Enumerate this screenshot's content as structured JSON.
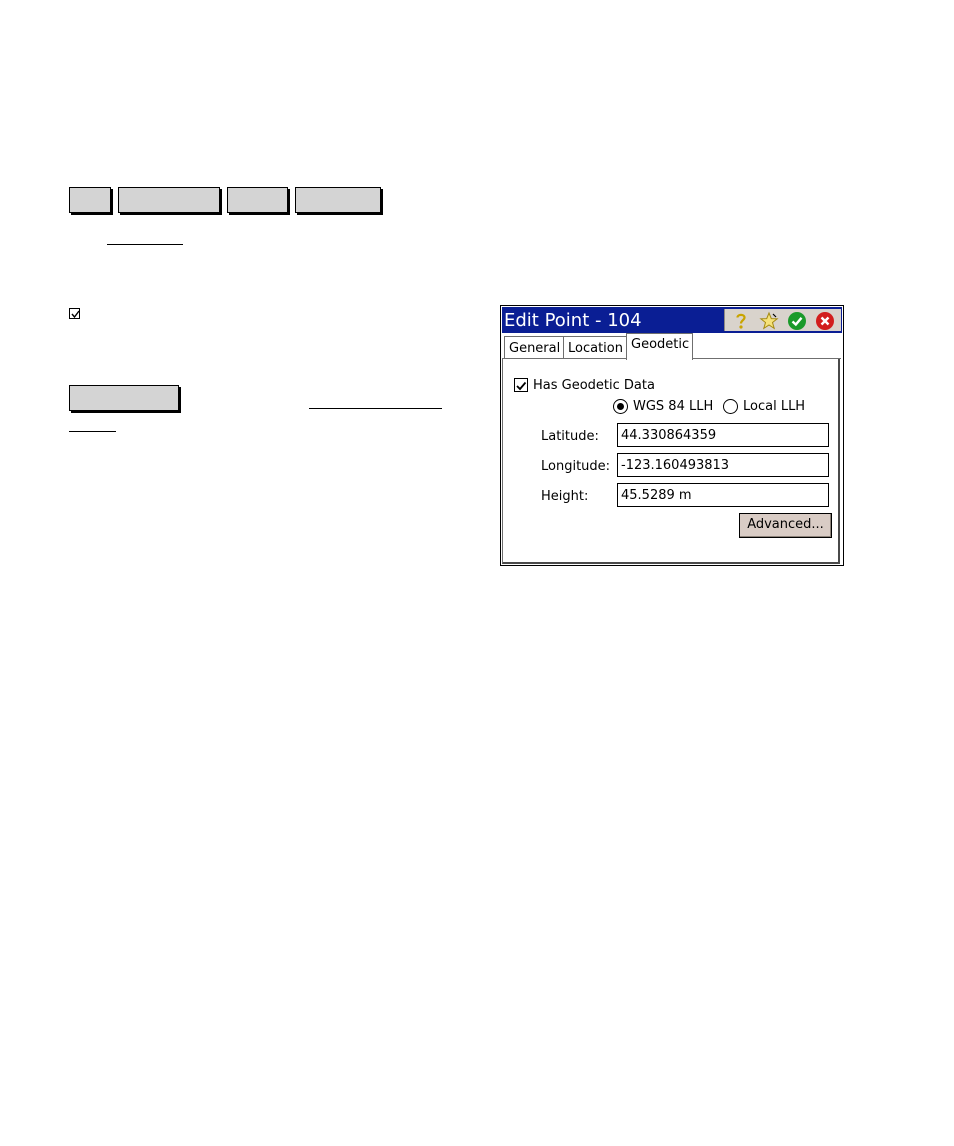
{
  "dialog": {
    "title": "Edit Point - 104",
    "tabs": [
      {
        "label": "General",
        "active": false
      },
      {
        "label": "Location",
        "active": false
      },
      {
        "label": "Geodetic",
        "active": true
      }
    ],
    "has_geodetic_label": "Has Geodetic Data",
    "has_geodetic_checked": true,
    "coordinate_options": [
      {
        "label": "WGS 84 LLH",
        "selected": true
      },
      {
        "label": "Local LLH",
        "selected": false
      }
    ],
    "fields": {
      "latitude": {
        "label": "Latitude:",
        "value": "44.330864359"
      },
      "longitude": {
        "label": "Longitude:",
        "value": "-123.160493813"
      },
      "height": {
        "label": "Height:",
        "value": "45.5289 m"
      }
    },
    "advanced_label": "Advanced...",
    "icons": [
      "help-icon",
      "favorite-star-icon",
      "ok-check-icon",
      "close-icon"
    ],
    "colors": {
      "titlebar": "#0a1e94",
      "accent_ok": "#1a9a2a",
      "accent_close": "#d21e1e"
    }
  }
}
